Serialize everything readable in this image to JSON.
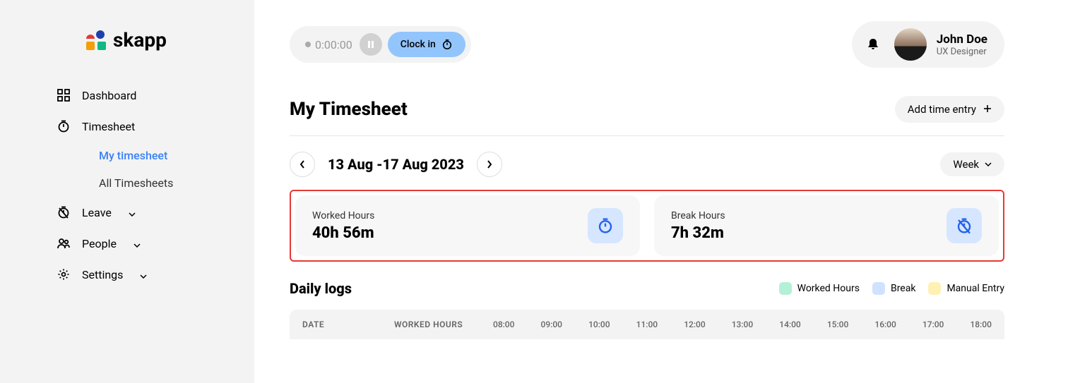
{
  "brand": "skapp",
  "sidebar": {
    "items": [
      {
        "label": "Dashboard"
      },
      {
        "label": "Timesheet"
      },
      {
        "label": "Leave"
      },
      {
        "label": "People"
      },
      {
        "label": "Settings"
      }
    ],
    "sub": {
      "my": "My timesheet",
      "all": "All Timesheets"
    }
  },
  "clock": {
    "timer": "0:00:00",
    "clock_in": "Clock in"
  },
  "user": {
    "name": "John Doe",
    "role": "UX Designer"
  },
  "page": {
    "title": "My Timesheet",
    "add_entry": "Add time entry"
  },
  "dateNav": {
    "range": "13 Aug -17 Aug 2023",
    "period": "Week"
  },
  "stats": {
    "worked": {
      "label": "Worked Hours",
      "value": "40h 56m"
    },
    "break": {
      "label": "Break Hours",
      "value": "7h 32m"
    }
  },
  "logs": {
    "title": "Daily logs",
    "legend": {
      "worked": "Worked Hours",
      "break": "Break",
      "manual": "Manual Entry"
    },
    "columns": {
      "date": "DATE",
      "worked": "WORKED HOURS"
    },
    "hours": [
      "08:00",
      "09:00",
      "10:00",
      "11:00",
      "12:00",
      "13:00",
      "14:00",
      "15:00",
      "16:00",
      "17:00",
      "18:00"
    ]
  },
  "colors": {
    "worked": "#b4f0d7",
    "break": "#cfe2ff",
    "manual": "#fff0b3"
  }
}
